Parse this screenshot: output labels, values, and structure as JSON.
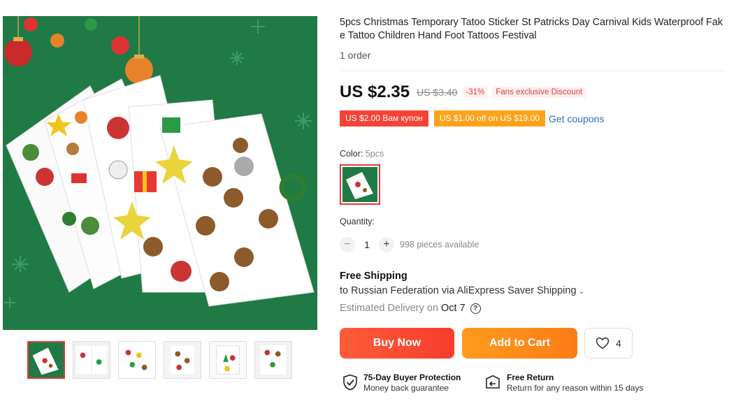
{
  "product": {
    "title": "5pcs Christmas Temporary Tatoo Sticker St Patricks Day Carnival Kids Waterproof Fake Tattoo Children Hand Foot Tattoos Festival",
    "orders": "1 order"
  },
  "price": {
    "current": "US $2.35",
    "original": "US $3.40",
    "discount": "-31%",
    "fans_badge": "Fans exclusive Discount"
  },
  "coupons": {
    "coupon1": "US $2.00 Вам купон",
    "coupon2": "US $1.00 off on US $19.00",
    "get_coupons": "Get coupons"
  },
  "color": {
    "label": "Color:",
    "selected": "5pcs"
  },
  "quantity": {
    "label": "Quantity:",
    "minus": "−",
    "value": "1",
    "plus": "+",
    "available": "998 pieces available"
  },
  "shipping": {
    "title": "Free Shipping",
    "destination": "to Russian Federation via AliExpress Saver Shipping",
    "chevron": "⌄",
    "delivery_label": "Estimated Delivery on",
    "delivery_date": "Oct 7",
    "help": "?"
  },
  "actions": {
    "buy_now": "Buy Now",
    "add_to_cart": "Add to Cart",
    "wishlist_count": "4"
  },
  "guarantees": {
    "protection_title": "75-Day Buyer Protection",
    "protection_sub": "Money back guarantee",
    "return_title": "Free Return",
    "return_sub": "Return for any reason within 15 days"
  },
  "colors": {
    "brand_red": "#f44336",
    "brand_orange": "#ffa21b",
    "link_blue": "#2f6fb5",
    "image_green": "#1f7a45"
  }
}
